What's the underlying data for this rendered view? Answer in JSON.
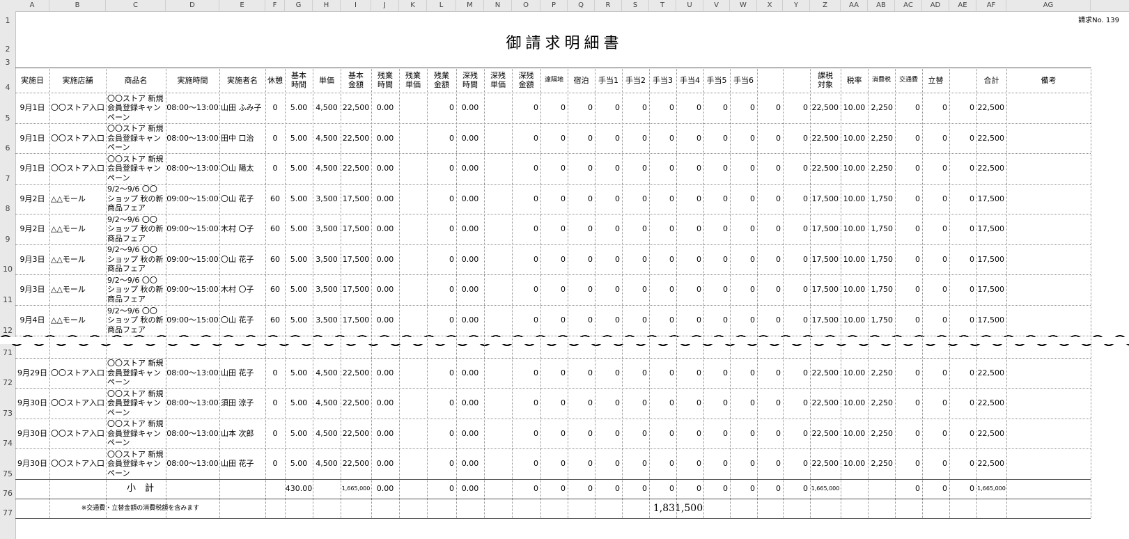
{
  "columns": [
    "A",
    "B",
    "C",
    "D",
    "E",
    "F",
    "G",
    "H",
    "I",
    "J",
    "K",
    "L",
    "M",
    "N",
    "O",
    "P",
    "Q",
    "R",
    "S",
    "T",
    "U",
    "V",
    "W",
    "X",
    "Y",
    "Z",
    "AA",
    "AB",
    "AC",
    "AD",
    "AE",
    "AF",
    "AG"
  ],
  "title": "御請求明細書",
  "invoice_no": "請求No. 139",
  "headers": {
    "date": "実施日",
    "store": "実施店舗",
    "product": "商品名",
    "time": "実施時間",
    "person": "実施者名",
    "rest": "休憩",
    "base_hours_1": "基本",
    "base_hours_2": "時間",
    "unit_price": "単価",
    "base_amount_1": "基本",
    "base_amount_2": "金額",
    "ot_hours_1": "残業",
    "ot_hours_2": "時間",
    "ot_price_1": "残業",
    "ot_price_2": "単価",
    "ot_amount_1": "残業",
    "ot_amount_2": "金額",
    "night_hours_1": "深残",
    "night_hours_2": "時間",
    "night_price_1": "深残",
    "night_price_2": "単価",
    "night_amount_1": "深残",
    "night_amount_2": "金額",
    "remote": "遠隔地",
    "lodging": "宿泊",
    "allow1": "手当1",
    "allow2": "手当2",
    "allow3": "手当3",
    "allow4": "手当4",
    "allow5": "手当5",
    "allow6": "手当6",
    "taxable_1": "課税",
    "taxable_2": "対象",
    "tax_rate": "税率",
    "consumption_tax": "消費税",
    "transport": "交通費",
    "advance": "立替",
    "total": "合計",
    "notes": "備考"
  },
  "row_numbers": [
    "1",
    "2",
    "3",
    "4",
    "5",
    "6",
    "7",
    "8",
    "9",
    "10",
    "11",
    "12",
    "71",
    "72",
    "73",
    "74",
    "75",
    "76",
    "77"
  ],
  "rows": [
    {
      "date": "9月1日",
      "store": "〇〇ストア入口",
      "product": [
        "〇〇ストア 新規",
        "会員登録キャン",
        "ペーン"
      ],
      "time": "08:00〜13:00",
      "person": "山田 ふみ子",
      "rest": "0",
      "hours": "5.00",
      "price": "4,500",
      "base": "22,500",
      "ot": "0.00",
      "otamt": "0",
      "night": "0.00",
      "zeros": [
        "0",
        "0",
        "0",
        "0",
        "0",
        "0",
        "0",
        "0",
        "0",
        "0",
        "0"
      ],
      "taxable": "22,500",
      "rate": "10.00",
      "tax": "2,250",
      "transport": "0",
      "advance": "0",
      "blank": "0",
      "total": "22,500"
    },
    {
      "date": "9月1日",
      "store": "〇〇ストア入口",
      "product": [
        "〇〇ストア 新規",
        "会員登録キャン",
        "ペーン"
      ],
      "time": "08:00〜13:00",
      "person": "田中 口治",
      "rest": "0",
      "hours": "5.00",
      "price": "4,500",
      "base": "22,500",
      "ot": "0.00",
      "otamt": "0",
      "night": "0.00",
      "zeros": [
        "0",
        "0",
        "0",
        "0",
        "0",
        "0",
        "0",
        "0",
        "0",
        "0",
        "0"
      ],
      "taxable": "22,500",
      "rate": "10.00",
      "tax": "2,250",
      "transport": "0",
      "advance": "0",
      "blank": "0",
      "total": "22,500"
    },
    {
      "date": "9月1日",
      "store": "〇〇ストア入口",
      "product": [
        "〇〇ストア 新規",
        "会員登録キャン",
        "ペーン"
      ],
      "time": "08:00〜13:00",
      "person": "〇山 陽太",
      "rest": "0",
      "hours": "5.00",
      "price": "4,500",
      "base": "22,500",
      "ot": "0.00",
      "otamt": "0",
      "night": "0.00",
      "zeros": [
        "0",
        "0",
        "0",
        "0",
        "0",
        "0",
        "0",
        "0",
        "0",
        "0",
        "0"
      ],
      "taxable": "22,500",
      "rate": "10.00",
      "tax": "2,250",
      "transport": "0",
      "advance": "0",
      "blank": "0",
      "total": "22,500"
    },
    {
      "date": "9月2日",
      "store": "△△モール",
      "product": [
        "9/2〜9/6 〇〇",
        "ショップ 秋の新",
        "商品フェア"
      ],
      "time": "09:00〜15:00",
      "person": "〇山 花子",
      "rest": "60",
      "hours": "5.00",
      "price": "3,500",
      "base": "17,500",
      "ot": "0.00",
      "otamt": "0",
      "night": "0.00",
      "zeros": [
        "0",
        "0",
        "0",
        "0",
        "0",
        "0",
        "0",
        "0",
        "0",
        "0",
        "0"
      ],
      "taxable": "17,500",
      "rate": "10.00",
      "tax": "1,750",
      "transport": "0",
      "advance": "0",
      "blank": "0",
      "total": "17,500"
    },
    {
      "date": "9月2日",
      "store": "△△モール",
      "product": [
        "9/2〜9/6 〇〇",
        "ショップ 秋の新",
        "商品フェア"
      ],
      "time": "09:00〜15:00",
      "person": "木村 〇子",
      "rest": "60",
      "hours": "5.00",
      "price": "3,500",
      "base": "17,500",
      "ot": "0.00",
      "otamt": "0",
      "night": "0.00",
      "zeros": [
        "0",
        "0",
        "0",
        "0",
        "0",
        "0",
        "0",
        "0",
        "0",
        "0",
        "0"
      ],
      "taxable": "17,500",
      "rate": "10.00",
      "tax": "1,750",
      "transport": "0",
      "advance": "0",
      "blank": "0",
      "total": "17,500"
    },
    {
      "date": "9月3日",
      "store": "△△モール",
      "product": [
        "9/2〜9/6 〇〇",
        "ショップ 秋の新",
        "商品フェア"
      ],
      "time": "09:00〜15:00",
      "person": "〇山 花子",
      "rest": "60",
      "hours": "5.00",
      "price": "3,500",
      "base": "17,500",
      "ot": "0.00",
      "otamt": "0",
      "night": "0.00",
      "zeros": [
        "0",
        "0",
        "0",
        "0",
        "0",
        "0",
        "0",
        "0",
        "0",
        "0",
        "0"
      ],
      "taxable": "17,500",
      "rate": "10.00",
      "tax": "1,750",
      "transport": "0",
      "advance": "0",
      "blank": "0",
      "total": "17,500"
    },
    {
      "date": "9月3日",
      "store": "△△モール",
      "product": [
        "9/2〜9/6 〇〇",
        "ショップ 秋の新",
        "商品フェア"
      ],
      "time": "09:00〜15:00",
      "person": "木村 〇子",
      "rest": "60",
      "hours": "5.00",
      "price": "3,500",
      "base": "17,500",
      "ot": "0.00",
      "otamt": "0",
      "night": "0.00",
      "zeros": [
        "0",
        "0",
        "0",
        "0",
        "0",
        "0",
        "0",
        "0",
        "0",
        "0",
        "0"
      ],
      "taxable": "17,500",
      "rate": "10.00",
      "tax": "1,750",
      "transport": "0",
      "advance": "0",
      "blank": "0",
      "total": "17,500"
    },
    {
      "date": "9月4日",
      "store": "△△モール",
      "product": [
        "9/2〜9/6 〇〇",
        "ショップ 秋の新",
        "商品フェア"
      ],
      "time": "09:00〜15:00",
      "person": "〇山 花子",
      "rest": "60",
      "hours": "5.00",
      "price": "3,500",
      "base": "17,500",
      "ot": "0.00",
      "otamt": "0",
      "night": "0.00",
      "zeros": [
        "0",
        "0",
        "0",
        "0",
        "0",
        "0",
        "0",
        "0",
        "0",
        "0",
        "0"
      ],
      "taxable": "17,500",
      "rate": "10.00",
      "tax": "1,750",
      "transport": "0",
      "advance": "0",
      "blank": "0",
      "total": "17,500"
    },
    {
      "date": "9月29日",
      "store": "〇〇ストア入口",
      "product": [
        "〇〇ストア 新規",
        "会員登録キャン",
        "ペーン"
      ],
      "time": "08:00〜13:00",
      "person": "山田 花子",
      "rest": "0",
      "hours": "5.00",
      "price": "4,500",
      "base": "22,500",
      "ot": "0.00",
      "otamt": "0",
      "night": "0.00",
      "zeros": [
        "0",
        "0",
        "0",
        "0",
        "0",
        "0",
        "0",
        "0",
        "0",
        "0",
        "0"
      ],
      "taxable": "22,500",
      "rate": "10.00",
      "tax": "2,250",
      "transport": "0",
      "advance": "0",
      "blank": "0",
      "total": "22,500"
    },
    {
      "date": "9月30日",
      "store": "〇〇ストア入口",
      "product": [
        "〇〇ストア 新規",
        "会員登録キャン",
        "ペーン"
      ],
      "time": "08:00〜13:00",
      "person": "須田 涼子",
      "rest": "0",
      "hours": "5.00",
      "price": "4,500",
      "base": "22,500",
      "ot": "0.00",
      "otamt": "0",
      "night": "0.00",
      "zeros": [
        "0",
        "0",
        "0",
        "0",
        "0",
        "0",
        "0",
        "0",
        "0",
        "0",
        "0"
      ],
      "taxable": "22,500",
      "rate": "10.00",
      "tax": "2,250",
      "transport": "0",
      "advance": "0",
      "blank": "0",
      "total": "22,500"
    },
    {
      "date": "9月30日",
      "store": "〇〇ストア入口",
      "product": [
        "〇〇ストア 新規",
        "会員登録キャン",
        "ペーン"
      ],
      "time": "08:00〜13:00",
      "person": "山本 次郎",
      "rest": "0",
      "hours": "5.00",
      "price": "4,500",
      "base": "22,500",
      "ot": "0.00",
      "otamt": "0",
      "night": "0.00",
      "zeros": [
        "0",
        "0",
        "0",
        "0",
        "0",
        "0",
        "0",
        "0",
        "0",
        "0",
        "0"
      ],
      "taxable": "22,500",
      "rate": "10.00",
      "tax": "2,250",
      "transport": "0",
      "advance": "0",
      "blank": "0",
      "total": "22,500"
    },
    {
      "date": "9月30日",
      "store": "〇〇ストア入口",
      "product": [
        "〇〇ストア 新規",
        "会員登録キャン",
        "ペーン"
      ],
      "time": "08:00〜13:00",
      "person": "山田 花子",
      "rest": "0",
      "hours": "5.00",
      "price": "4,500",
      "base": "22,500",
      "ot": "0.00",
      "otamt": "0",
      "night": "0.00",
      "zeros": [
        "0",
        "0",
        "0",
        "0",
        "0",
        "0",
        "0",
        "0",
        "0",
        "0",
        "0"
      ],
      "taxable": "22,500",
      "rate": "10.00",
      "tax": "2,250",
      "transport": "0",
      "advance": "0",
      "blank": "0",
      "total": "22,500"
    }
  ],
  "subtotal": {
    "label": "小　計",
    "hours": "430.00",
    "base": "1,665,000",
    "ot": "0.00",
    "otamt": "0",
    "night": "0.00",
    "zeros": [
      "0",
      "0",
      "0",
      "0",
      "0",
      "0",
      "0",
      "0",
      "0",
      "0",
      "0"
    ],
    "taxable": "1,665,000",
    "transport": "0",
    "advance": "0",
    "blank": "0",
    "total": "1,665,000"
  },
  "footer": {
    "note": "※交通費・立替金額の消費税額を含みます",
    "grand_total": "1,831,500"
  }
}
